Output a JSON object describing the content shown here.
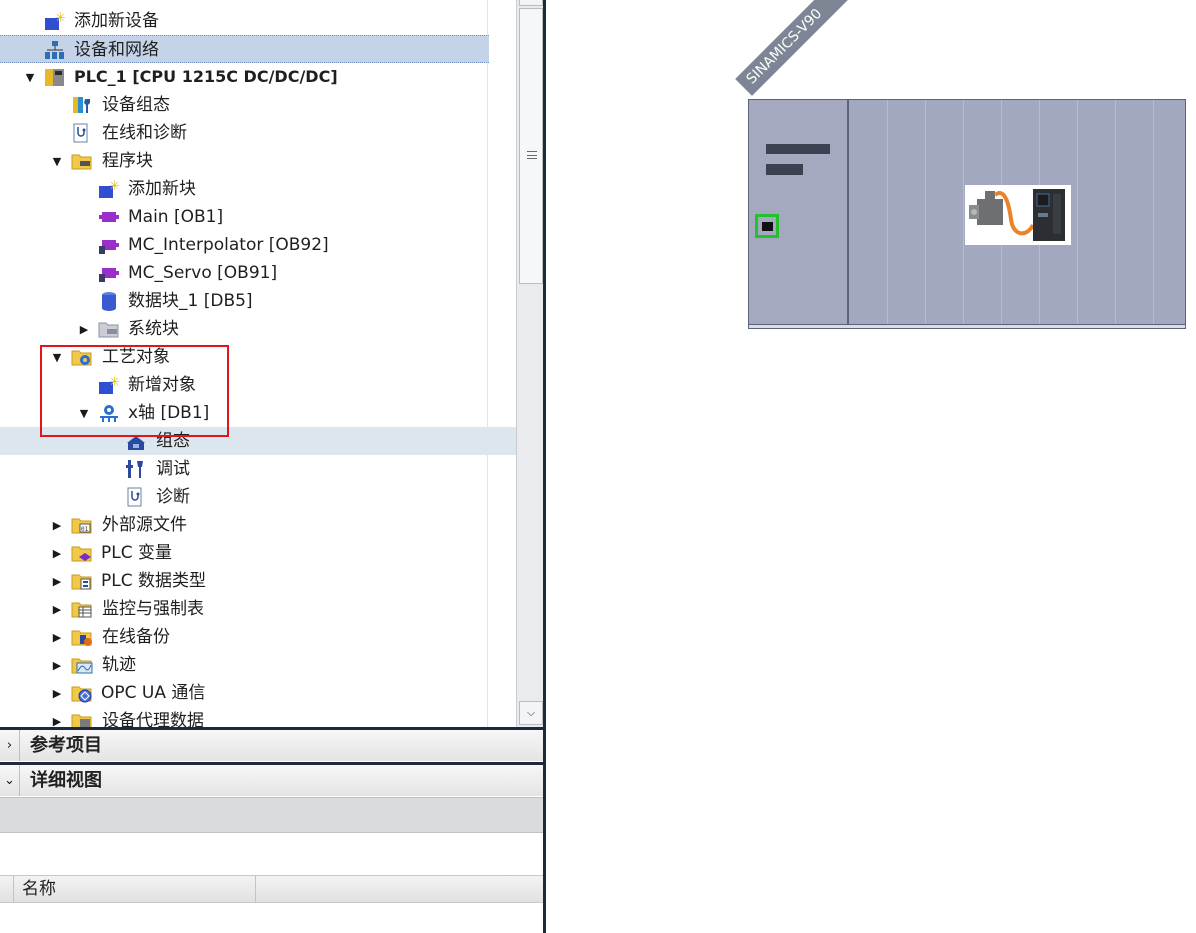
{
  "tree": {
    "items": [
      {
        "label": "添加新设备",
        "icon": "add-device-icon"
      },
      {
        "label": "设备和网络",
        "icon": "devices-networks-icon"
      },
      {
        "label": "PLC_1 [CPU 1215C DC/DC/DC]",
        "icon": "plc-icon"
      },
      {
        "label": "设备组态",
        "icon": "device-config-icon"
      },
      {
        "label": "在线和诊断",
        "icon": "online-diagnostics-icon"
      },
      {
        "label": "程序块",
        "icon": "folder-program-blocks-icon"
      },
      {
        "label": "添加新块",
        "icon": "add-block-icon"
      },
      {
        "label": "Main [OB1]",
        "icon": "ob-block-icon"
      },
      {
        "label": "MC_Interpolator [OB92]",
        "icon": "ob-block-icon"
      },
      {
        "label": "MC_Servo [OB91]",
        "icon": "ob-block-icon"
      },
      {
        "label": "数据块_1 [DB5]",
        "icon": "data-block-icon"
      },
      {
        "label": "系统块",
        "icon": "folder-system-blocks-icon"
      },
      {
        "label": "工艺对象",
        "icon": "folder-technology-objects-icon"
      },
      {
        "label": "新增对象",
        "icon": "add-object-icon"
      },
      {
        "label": "x轴 [DB1]",
        "icon": "axis-object-icon"
      },
      {
        "label": "组态",
        "icon": "configuration-icon"
      },
      {
        "label": "调试",
        "icon": "commissioning-icon"
      },
      {
        "label": "诊断",
        "icon": "diagnostics-icon"
      },
      {
        "label": "外部源文件",
        "icon": "folder-external-sources-icon"
      },
      {
        "label": "PLC 变量",
        "icon": "folder-plc-tags-icon"
      },
      {
        "label": "PLC 数据类型",
        "icon": "folder-plc-data-types-icon"
      },
      {
        "label": "监控与强制表",
        "icon": "folder-watch-force-tables-icon"
      },
      {
        "label": "在线备份",
        "icon": "folder-online-backups-icon"
      },
      {
        "label": "轨迹",
        "icon": "folder-traces-icon"
      },
      {
        "label": "OPC UA 通信",
        "icon": "folder-opc-ua-icon"
      },
      {
        "label": "设备代理数据",
        "icon": "folder-device-proxy-icon"
      }
    ]
  },
  "sections": {
    "reference_projects": "参考项目",
    "details_view": "详细视图"
  },
  "details": {
    "column_name": "名称"
  },
  "network": {
    "device_name": "SINAMICS-V90"
  },
  "colors": {
    "selection": "#c5d3e8",
    "highlight_box": "#e0161c",
    "device_body": "#a2a8bf",
    "port_border": "#23c12a"
  }
}
